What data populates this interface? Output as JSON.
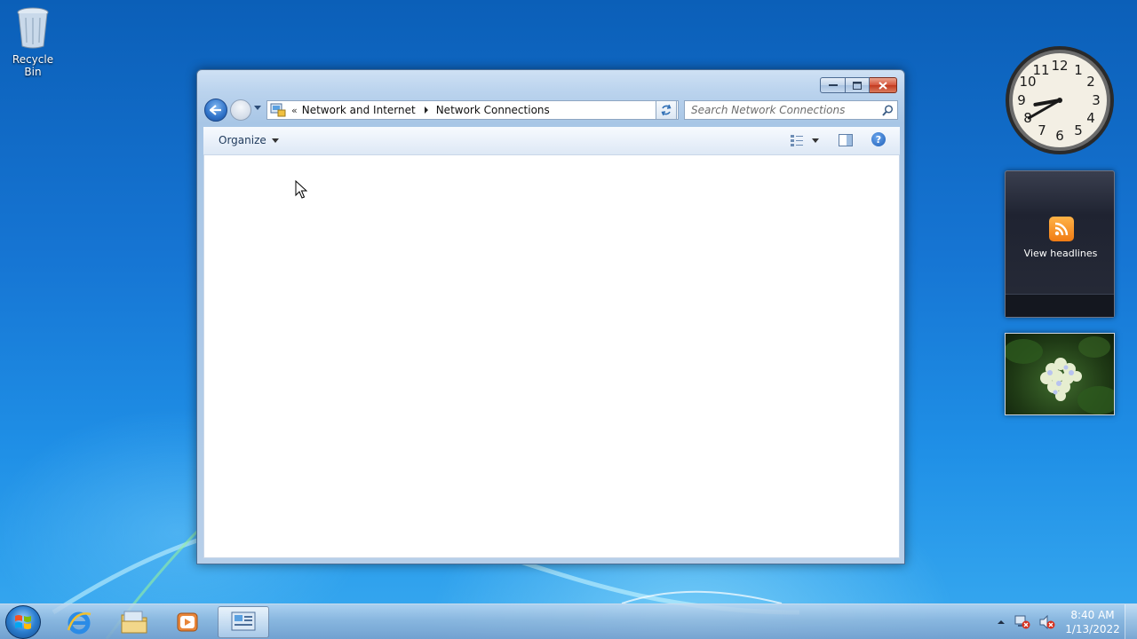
{
  "desktop": {
    "recycle_bin_label": "Recycle Bin"
  },
  "explorer": {
    "breadcrumb": {
      "overflow": "«",
      "items": [
        "Network and Internet",
        "Network Connections"
      ]
    },
    "search_placeholder": "Search Network Connections",
    "commandbar": {
      "organize_label": "Organize",
      "help_symbol": "?"
    },
    "icons": {
      "back": "back-arrow-icon",
      "forward": "forward-arrow-icon",
      "refresh": "refresh-icon",
      "search": "magnifier-icon",
      "views": "change-view-icon",
      "preview": "preview-pane-icon",
      "help": "help-icon"
    }
  },
  "gadgets": {
    "clock": {
      "numbers": [
        "12",
        "1",
        "2",
        "3",
        "4",
        "5",
        "6",
        "7",
        "8",
        "9",
        "10",
        "11"
      ],
      "time_shown": "8:40"
    },
    "feed": {
      "label": "View headlines",
      "icon": "rss-icon",
      "icon_color": "#F07B14"
    },
    "slideshow": {
      "icon": "hydrangea-photo"
    }
  },
  "taskbar": {
    "pinned": [
      "start-orb-icon",
      "internet-explorer-icon",
      "windows-explorer-icon",
      "media-player-icon",
      "network-connections-icon"
    ],
    "tray": {
      "time": "8:40 AM",
      "date": "1/13/2022",
      "icons": [
        "show-hidden-icons-arrow",
        "network-disconnected-icon",
        "volume-muted-icon"
      ]
    }
  },
  "colors": {
    "desktop_blue": "#1675D3",
    "close_button_red": "#C23A20"
  }
}
